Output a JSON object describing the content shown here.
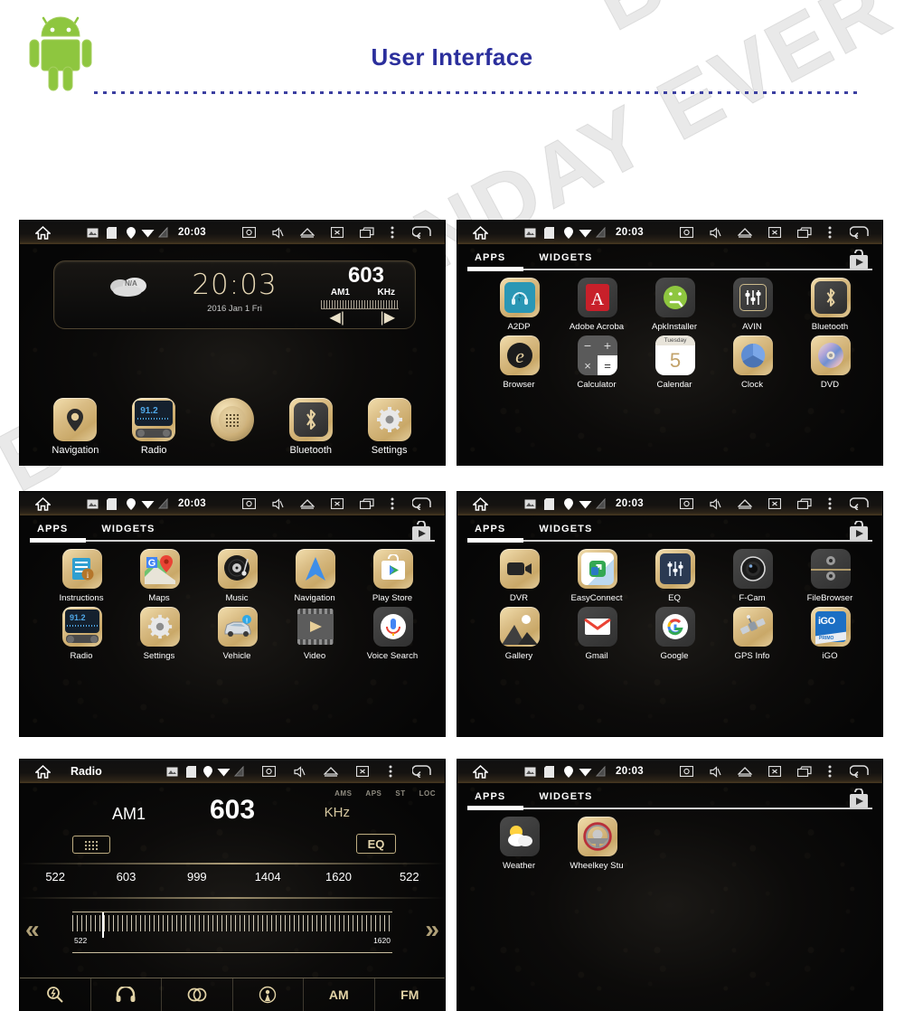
{
  "header": {
    "title": "User Interface",
    "title_color": "#2b2f9c",
    "logo_icon": "android-robot-icon"
  },
  "watermark": {
    "text": "BLACK SUNDAY EVERYDAY"
  },
  "statusbar": {
    "time": "20:03",
    "icons": [
      "home-icon",
      "picture-icon",
      "sdcard-icon",
      "location-icon",
      "wifi-icon",
      "signal-icon",
      "screenshot-icon",
      "mute-icon",
      "eject-icon",
      "close-screen-icon",
      "recent-apps-icon",
      "overflow-menu-icon",
      "back-icon"
    ]
  },
  "tabs": {
    "apps": "APPS",
    "widgets": "WIDGETS",
    "playstore_icon": "play-store-icon"
  },
  "screens": [
    {
      "id": "home",
      "type": "home",
      "widget": {
        "weather": "N/A",
        "clock": "20:03",
        "date": "2016 Jan 1 Fri",
        "freq": "603",
        "band": "AM1",
        "unit": "KHz",
        "prev_icon": "prev-track-icon",
        "next_icon": "next-track-icon"
      },
      "dock": [
        {
          "label": "Navigation",
          "icon": "navigation-pin-icon",
          "style": "gold"
        },
        {
          "label": "Radio",
          "icon": "radio-tuner-icon",
          "style": "radio"
        },
        {
          "label": "",
          "icon": "app-drawer-icon",
          "style": "drawer"
        },
        {
          "label": "Bluetooth",
          "icon": "bluetooth-icon",
          "style": "gold"
        },
        {
          "label": "Settings",
          "icon": "gear-icon",
          "style": "gold"
        }
      ]
    },
    {
      "id": "apps-1",
      "type": "apps",
      "rows": [
        [
          {
            "label": "A2DP",
            "icon": "a2dp-icon",
            "style": "gold"
          },
          {
            "label": "Adobe Acroba",
            "icon": "adobe-acrobat-icon",
            "style": "grey"
          },
          {
            "label": "ApkInstaller",
            "icon": "apk-installer-icon",
            "style": "grey"
          },
          {
            "label": "AVIN",
            "icon": "avin-icon",
            "style": "grey"
          },
          {
            "label": "Bluetooth",
            "icon": "bluetooth-icon",
            "style": "gold"
          }
        ],
        [
          {
            "label": "Browser",
            "icon": "browser-e-icon",
            "style": "gold"
          },
          {
            "label": "Calculator",
            "icon": "calculator-icon",
            "style": "grey"
          },
          {
            "label": "Calendar",
            "icon": "calendar-icon",
            "style": "white"
          },
          {
            "label": "Clock",
            "icon": "clock-icon",
            "style": "gold"
          },
          {
            "label": "DVD",
            "icon": "dvd-disc-icon",
            "style": "gold"
          }
        ]
      ]
    },
    {
      "id": "apps-2",
      "type": "apps",
      "rows": [
        [
          {
            "label": "Instructions",
            "icon": "instructions-icon",
            "style": "gold"
          },
          {
            "label": "Maps",
            "icon": "google-maps-icon",
            "style": "gold"
          },
          {
            "label": "Music",
            "icon": "music-vinyl-icon",
            "style": "gold"
          },
          {
            "label": "Navigation",
            "icon": "navigation-arrow-icon",
            "style": "gold"
          },
          {
            "label": "Play Store",
            "icon": "play-store-icon",
            "style": "gold"
          }
        ],
        [
          {
            "label": "Radio",
            "icon": "radio-tuner-icon",
            "style": "radio"
          },
          {
            "label": "Settings",
            "icon": "gear-icon",
            "style": "gold"
          },
          {
            "label": "Vehicle",
            "icon": "vehicle-car-icon",
            "style": "gold"
          },
          {
            "label": "Video",
            "icon": "video-film-icon",
            "style": "grey"
          },
          {
            "label": "Voice Search",
            "icon": "voice-search-mic-icon",
            "style": "grey"
          }
        ]
      ]
    },
    {
      "id": "apps-3",
      "type": "apps",
      "rows": [
        [
          {
            "label": "DVR",
            "icon": "dvr-camcorder-icon",
            "style": "gold"
          },
          {
            "label": "EasyConnect",
            "icon": "easyconnect-icon",
            "style": "gold"
          },
          {
            "label": "EQ",
            "icon": "equalizer-icon",
            "style": "gold"
          },
          {
            "label": "F-Cam",
            "icon": "front-camera-icon",
            "style": "grey"
          },
          {
            "label": "FileBrowser",
            "icon": "file-browser-icon",
            "style": "grey"
          }
        ],
        [
          {
            "label": "Gallery",
            "icon": "gallery-photo-icon",
            "style": "gold"
          },
          {
            "label": "Gmail",
            "icon": "gmail-icon",
            "style": "grey"
          },
          {
            "label": "Google",
            "icon": "google-g-icon",
            "style": "grey"
          },
          {
            "label": "GPS Info",
            "icon": "gps-satellite-icon",
            "style": "gold"
          },
          {
            "label": "iGO",
            "icon": "igo-icon",
            "style": "gold"
          }
        ]
      ]
    },
    {
      "id": "radio",
      "type": "radio",
      "title": "Radio",
      "flags": [
        "AMS",
        "APS",
        "ST",
        "LOC"
      ],
      "band": "AM1",
      "freq": "603",
      "unit": "KHz",
      "keypad_icon": "keypad-icon",
      "eq_label": "EQ",
      "presets": [
        "522",
        "603",
        "999",
        "1404",
        "1620",
        "522"
      ],
      "scale_low": "522",
      "scale_high": "1620",
      "toolbar": [
        {
          "label": "",
          "icon": "search-scan-icon"
        },
        {
          "label": "",
          "icon": "headphone-icon"
        },
        {
          "label": "",
          "icon": "stereo-rings-icon"
        },
        {
          "label": "",
          "icon": "antenna-broadcast-icon"
        },
        {
          "label": "AM",
          "icon": ""
        },
        {
          "label": "FM",
          "icon": ""
        }
      ]
    },
    {
      "id": "apps-4",
      "type": "apps",
      "rows": [
        [
          {
            "label": "Weather",
            "icon": "weather-sun-cloud-icon",
            "style": "grey"
          },
          {
            "label": "Wheelkey Stu",
            "icon": "steering-wheel-icon",
            "style": "gold"
          }
        ]
      ]
    }
  ]
}
